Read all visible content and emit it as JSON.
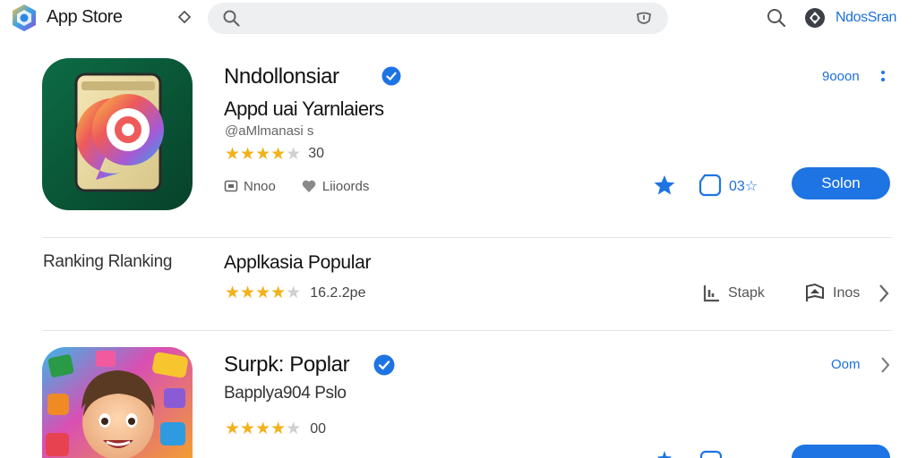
{
  "header": {
    "brand": "App Store",
    "search_placeholder": "",
    "user_label": "NdosSran",
    "icons": {
      "logo": "app-store-logo-icon",
      "diamond": "diamond-icon",
      "search": "search-icon",
      "mic": "mic-icon",
      "avatar": "avatar-icon"
    }
  },
  "featured": {
    "title": "Nndollonsiar",
    "subtitle": "Appd uai Yarnlaiers",
    "developer": "@aMlmanasi s",
    "rating_value": 4.0,
    "rating_text": "30",
    "meta": [
      {
        "icon": "storage-icon",
        "label": "Nnoo"
      },
      {
        "icon": "heart-icon",
        "label": "Liioords"
      }
    ],
    "link": "9ooon",
    "rate_chip": "03☆",
    "open_button": "Solon",
    "icons": {
      "verified": "verified-badge-icon",
      "more": "more-vertical-icon",
      "favorite": "star-icon",
      "share": "rounded-square-icon"
    }
  },
  "ranking": {
    "label": "Ranking Rlanking",
    "title": "Applkasia Popular",
    "rating_value": 4.0,
    "rating_text": "16.2.2pe",
    "actions": [
      {
        "icon": "download-icon",
        "label": "Stapk"
      },
      {
        "icon": "flag-icon",
        "label": "Inos"
      }
    ]
  },
  "second": {
    "title": "Surpk: Poplar",
    "subtitle": "Bapplya904 Pslo",
    "rating_value": 4.5,
    "rating_text": "00",
    "link": "Oom"
  },
  "colors": {
    "accent": "#1e74e3",
    "star": "#f2b21c",
    "divider": "#e3e3e3",
    "search_bg": "#eeeff1"
  }
}
